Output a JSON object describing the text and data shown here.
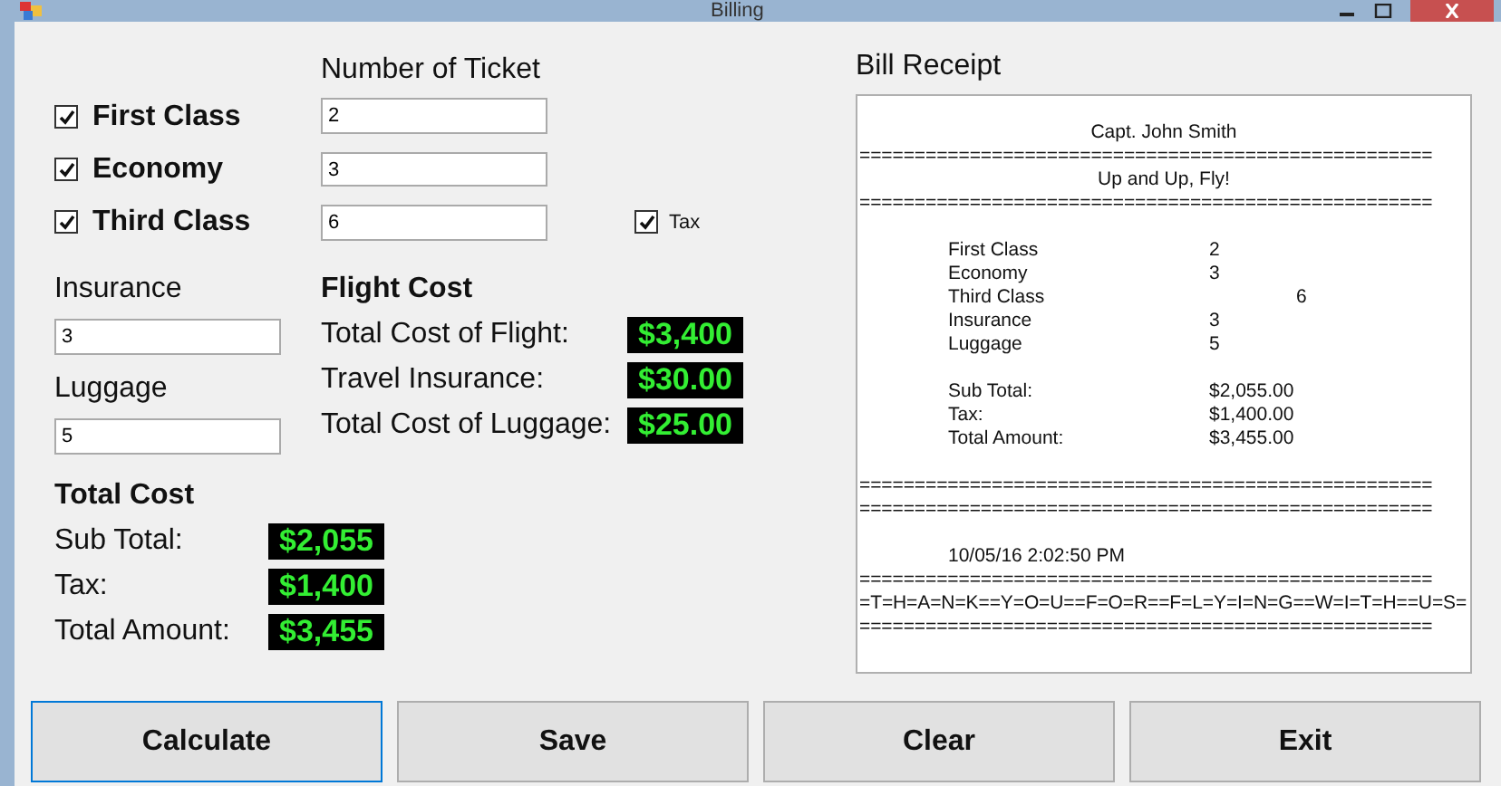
{
  "window": {
    "title": "Billing"
  },
  "ticket_header": "Number of Ticket",
  "classes": [
    {
      "label": "First Class",
      "checked": true,
      "tickets": "2"
    },
    {
      "label": "Economy",
      "checked": true,
      "tickets": "3"
    },
    {
      "label": "Third Class",
      "checked": true,
      "tickets": "6"
    }
  ],
  "tax": {
    "label": "Tax",
    "checked": true
  },
  "extras": [
    {
      "label": "Insurance",
      "value": "3"
    },
    {
      "label": "Luggage",
      "value": "5"
    }
  ],
  "flight_cost": {
    "title": "Flight Cost",
    "rows": [
      {
        "label": "Total Cost of Flight:",
        "value": "$3,400"
      },
      {
        "label": "Travel Insurance:",
        "value": "$30.00"
      },
      {
        "label": "Total Cost of Luggage:",
        "value": "$25.00"
      }
    ]
  },
  "total_cost": {
    "title": "Total Cost",
    "rows": [
      {
        "label": "Sub Total:",
        "value": "$2,055"
      },
      {
        "label": "Tax:",
        "value": "$1,400"
      },
      {
        "label": "Total Amount:",
        "value": "$3,455"
      }
    ]
  },
  "receipt": {
    "title": "Bill Receipt",
    "lines": [
      {
        "kind": "center",
        "text": "Capt. John Smith"
      },
      {
        "kind": "rule",
        "text": "===================================================="
      },
      {
        "kind": "center",
        "text": "Up and Up, Fly!"
      },
      {
        "kind": "rule",
        "text": "===================================================="
      },
      {
        "kind": "blank"
      },
      {
        "kind": "pair",
        "label": "First Class",
        "value": "2"
      },
      {
        "kind": "pair",
        "label": "Economy",
        "value": "3"
      },
      {
        "kind": "pair_far",
        "label": "Third Class",
        "value": "6"
      },
      {
        "kind": "pair",
        "label": "Insurance",
        "value": "3"
      },
      {
        "kind": "pair",
        "label": "Luggage",
        "value": "5"
      },
      {
        "kind": "blank"
      },
      {
        "kind": "pair",
        "label": "Sub Total:",
        "value": "$2,055.00"
      },
      {
        "kind": "pair",
        "label": "Tax:",
        "value": "$1,400.00"
      },
      {
        "kind": "pair",
        "label": "Total Amount:",
        "value": "$3,455.00"
      },
      {
        "kind": "blank"
      },
      {
        "kind": "rule",
        "text": "===================================================="
      },
      {
        "kind": "rule",
        "text": "===================================================="
      },
      {
        "kind": "blank"
      },
      {
        "kind": "text",
        "text": "10/05/16 2:02:50 PM"
      },
      {
        "kind": "rule",
        "text": "===================================================="
      },
      {
        "kind": "rule",
        "text": "=T=H=A=N=K==Y=O=U==F=O=R==F=L=Y=I=N=G==W=I=T=H==U=S="
      },
      {
        "kind": "rule",
        "text": "===================================================="
      }
    ]
  },
  "buttons": [
    {
      "label": "Calculate",
      "focused": true
    },
    {
      "label": "Save",
      "focused": false
    },
    {
      "label": "Clear",
      "focused": false
    },
    {
      "label": "Exit",
      "focused": false
    }
  ]
}
